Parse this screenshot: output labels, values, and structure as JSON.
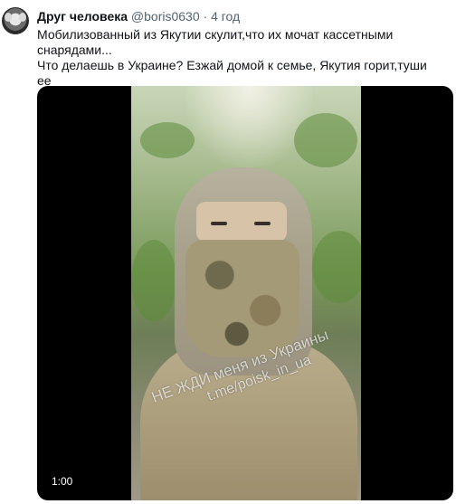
{
  "tweet": {
    "author_name": "Друг человека",
    "handle": "@boris0630",
    "separator": "·",
    "time": "4 год",
    "text_lines": [
      "Мобилизованный из Якутии скулит,что их мочат кассетными снарядами...",
      "Что делаешь в Украине? Езжай домой к семье, Якутия горит,туши ее"
    ],
    "avatar_icon": "lemur-avatar"
  },
  "video": {
    "watermark_line1": "НЕ ЖДИ меня из Украины",
    "watermark_line2": "t.me/poisk_in_ua",
    "duration": "1:00",
    "background_color": "#000000"
  }
}
